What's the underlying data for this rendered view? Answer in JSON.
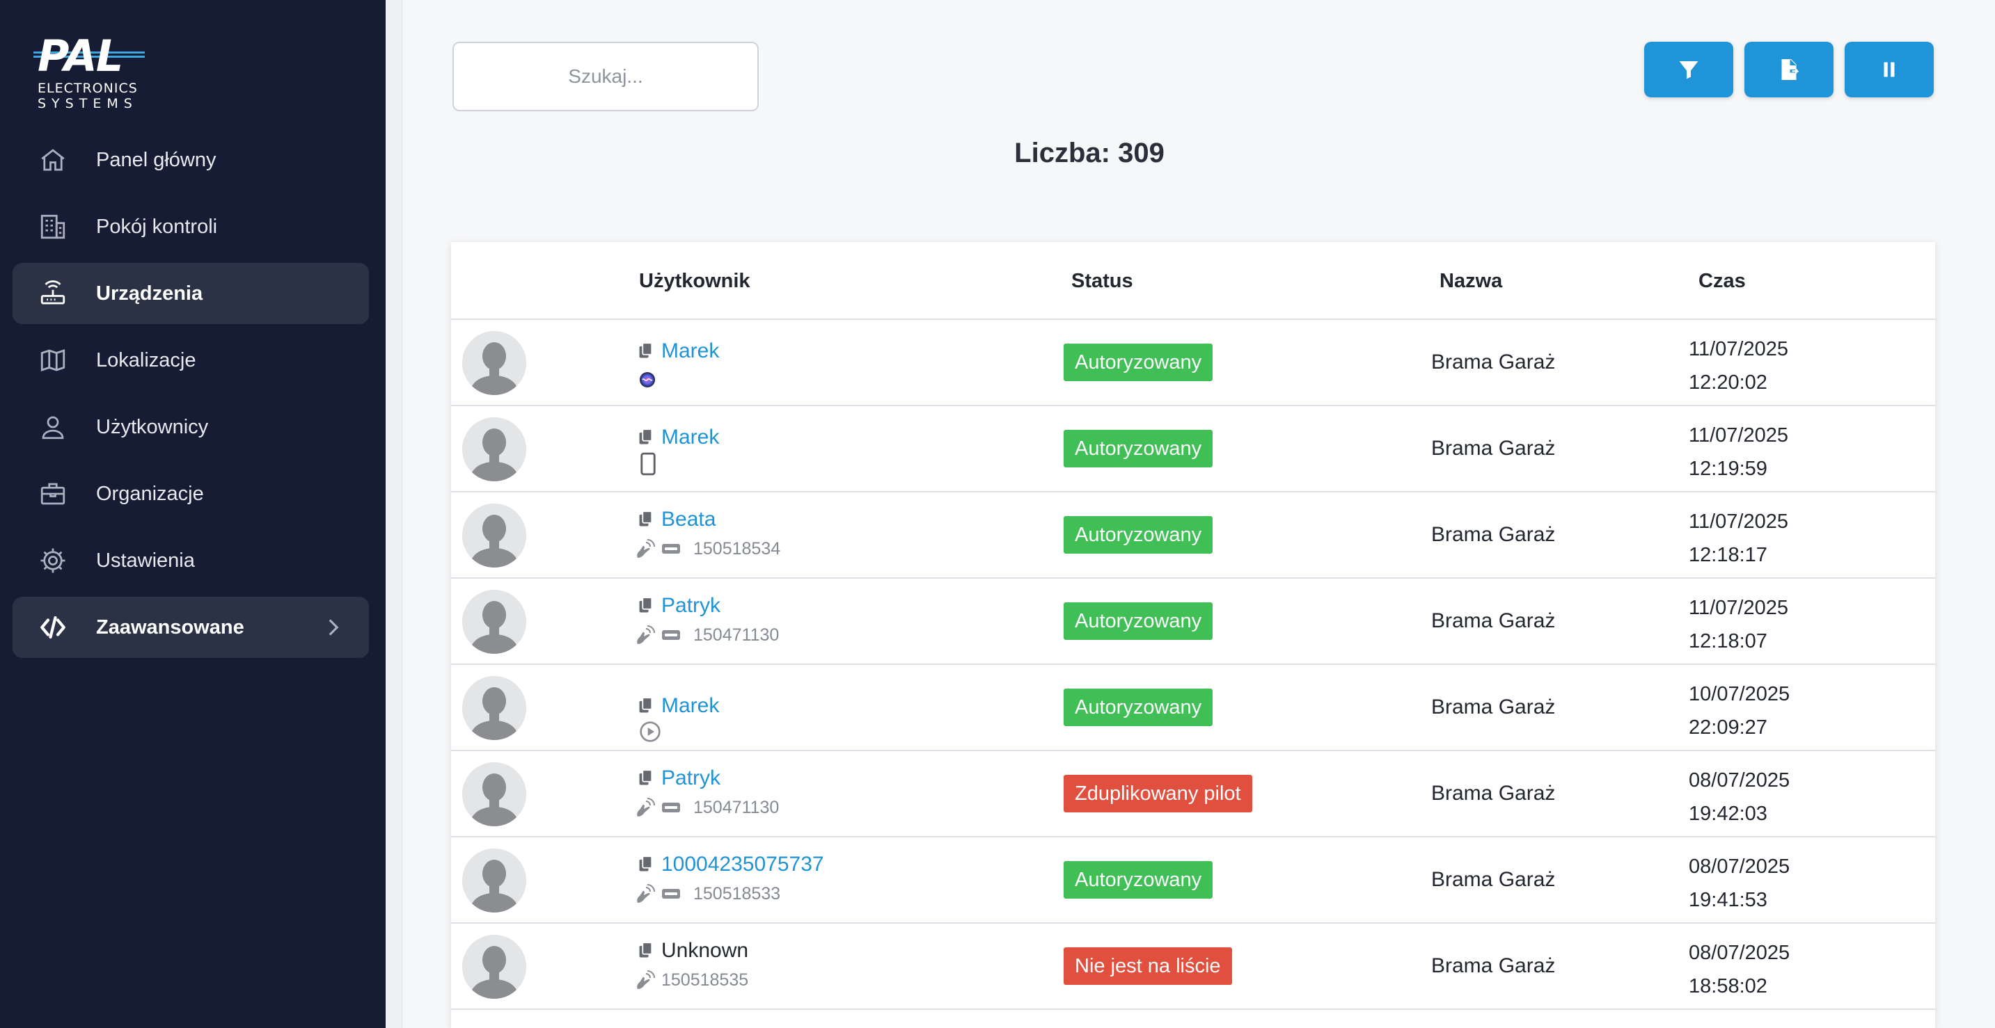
{
  "logo": {
    "brand": "PAL",
    "line1": "ELECTRONICS",
    "line2": "SYSTEMS"
  },
  "sidebar": {
    "items": [
      {
        "label": "Panel główny",
        "icon": "home-icon"
      },
      {
        "label": "Pokój kontroli",
        "icon": "building-icon"
      },
      {
        "label": "Urządzenia",
        "icon": "router-icon",
        "active": true
      },
      {
        "label": "Lokalizacje",
        "icon": "map-icon"
      },
      {
        "label": "Użytkownicy",
        "icon": "user-icon"
      },
      {
        "label": "Organizacje",
        "icon": "briefcase-icon"
      },
      {
        "label": "Ustawienia",
        "icon": "gear-icon"
      },
      {
        "label": "Zaawansowane",
        "icon": "code-icon",
        "expandable": true
      }
    ]
  },
  "search": {
    "placeholder": "Szukaj...",
    "value": ""
  },
  "toolbar": {
    "buttons": [
      "filter-icon",
      "export-icon",
      "pause-icon"
    ]
  },
  "count": {
    "text": "Liczba: 309"
  },
  "table": {
    "headers": {
      "user": "Użytkownik",
      "status": "Status",
      "name": "Nazwa",
      "time": "Czas"
    },
    "rows": [
      {
        "user": "Marek",
        "source": "siri-icon",
        "sub": "",
        "status": "Autoryzowany",
        "ok": true,
        "name": "Brama Garaż",
        "date": "11/07/2025",
        "clock": "12:20:02"
      },
      {
        "user": "Marek",
        "source": "phone-icon",
        "sub": "",
        "status": "Autoryzowany",
        "ok": true,
        "name": "Brama Garaż",
        "date": "11/07/2025",
        "clock": "12:19:59"
      },
      {
        "user": "Beata",
        "source": "remote-icon",
        "sub": "150518534",
        "status": "Autoryzowany",
        "ok": true,
        "name": "Brama Garaż",
        "date": "11/07/2025",
        "clock": "12:18:17"
      },
      {
        "user": "Patryk",
        "source": "remote-icon",
        "sub": "150471130",
        "status": "Autoryzowany",
        "ok": true,
        "name": "Brama Garaż",
        "date": "11/07/2025",
        "clock": "12:18:07"
      },
      {
        "user": "Marek",
        "source": "play-icon",
        "sub": "",
        "status": "Autoryzowany",
        "ok": true,
        "name": "Brama Garaż",
        "date": "10/07/2025",
        "clock": "22:09:27"
      },
      {
        "user": "Patryk",
        "source": "remote-icon",
        "sub": "150471130",
        "status": "Zduplikowany pilot",
        "ok": false,
        "name": "Brama Garaż",
        "date": "08/07/2025",
        "clock": "19:42:03"
      },
      {
        "user": "10004235075737",
        "source": "remote-icon",
        "sub": "150518533",
        "status": "Autoryzowany",
        "ok": true,
        "name": "Brama Garaż",
        "date": "08/07/2025",
        "clock": "19:41:53"
      },
      {
        "user": "Unknown",
        "source": "remote-icon",
        "sub": "150518535",
        "status": "Nie jest na liście",
        "ok": false,
        "name": "Brama Garaż",
        "date": "08/07/2025",
        "clock": "18:58:02",
        "unlinked": true
      }
    ]
  },
  "colors": {
    "sidebar": "#161c33",
    "accent": "#1f94d8",
    "ok": "#3fbf55",
    "bad": "#e1503f"
  }
}
